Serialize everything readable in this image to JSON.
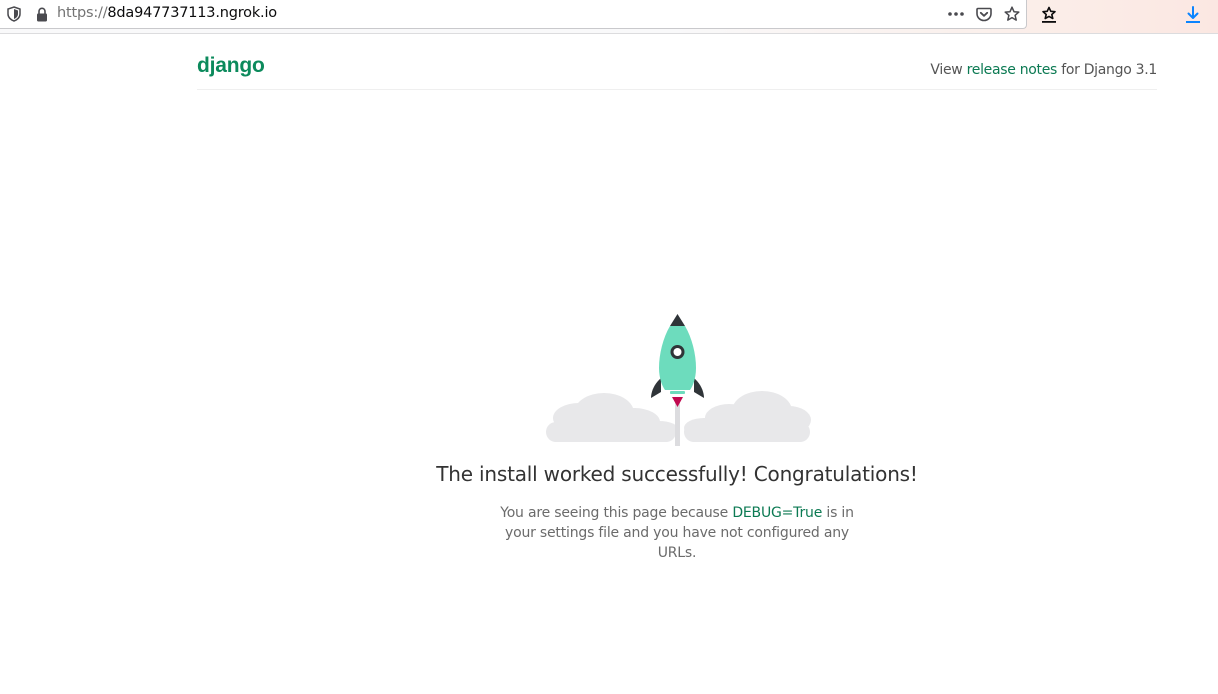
{
  "browser": {
    "url_scheme": "https://",
    "url_host": "8da947737113.ngrok.io",
    "icons": [
      "shield-icon",
      "lock-icon",
      "more-actions-icon",
      "pocket-icon",
      "bookmark-star-icon",
      "reading-list-icon",
      "download-icon"
    ]
  },
  "header": {
    "logo": "django",
    "release_prefix": "View ",
    "release_link": "release notes",
    "release_suffix": " for Django 3.1"
  },
  "main": {
    "headline": "The install worked successfully! Congratulations!",
    "body_prefix": "You are seeing this page because ",
    "body_debug": "DEBUG=True",
    "body_suffix": " is in your settings file and you have not configured any URLs."
  },
  "colors": {
    "brand": "#0c8a5c",
    "link": "#0c7a53",
    "rocket_body": "#6ddcbd",
    "rocket_fins": "#2f3438",
    "flame": "#c1094f",
    "clouds": "#e8e8ea",
    "download_accent": "#0a84ff"
  }
}
